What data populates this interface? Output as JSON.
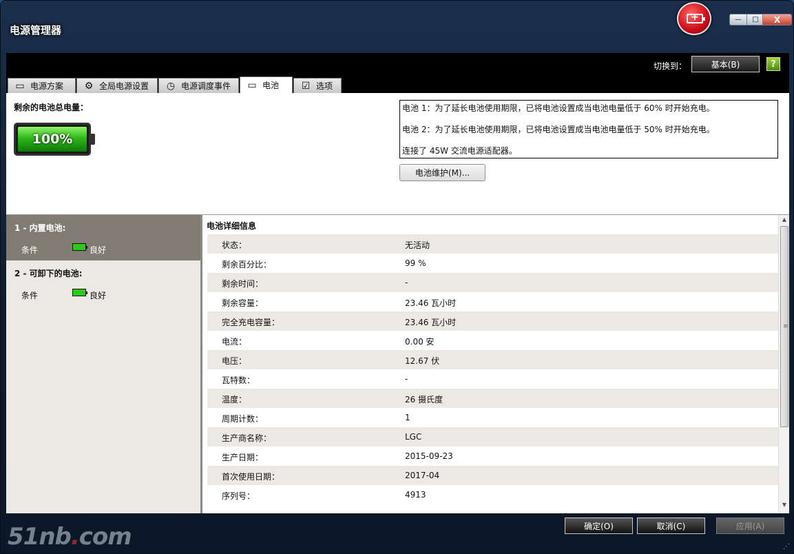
{
  "window": {
    "title": "电源管理器",
    "min_glyph": "—",
    "max_glyph": "□",
    "close_glyph": "X"
  },
  "header": {
    "switch_label": "切换到：",
    "basic_button": "基本(B)",
    "help_glyph": "?"
  },
  "tabs": [
    {
      "label": "电源方案",
      "icon": "battery-outline-icon",
      "glyph": "▭"
    },
    {
      "label": "全局电源设置",
      "icon": "gear-icon",
      "glyph": "⚙"
    },
    {
      "label": "电源调度事件",
      "icon": "clock-icon",
      "glyph": "◷"
    },
    {
      "label": "电池",
      "icon": "battery-icon",
      "glyph": "▭"
    },
    {
      "label": "选项",
      "icon": "checkbox-icon",
      "glyph": "☑"
    }
  ],
  "active_tab": "电池",
  "summary": {
    "remaining_label": "剩余的电池总电量：",
    "percent_text": "100%",
    "percent_value": 100,
    "messages": [
      "电池 1：为了延长电池使用期限，已将电池设置成当电池电量低于 60% 时开始充电。",
      "电池 2：为了延长电池使用期限，已将电池设置成当电池电量低于 50% 时开始充电。",
      "连接了 45W 交流电源适配器。"
    ],
    "maintenance_button": "电池维护(M)..."
  },
  "batteries": [
    {
      "name": "1 - 内置电池:",
      "condition_label": "条件",
      "status": "良好"
    },
    {
      "name": "2 - 可卸下的电池:",
      "condition_label": "条件",
      "status": "良好"
    }
  ],
  "details": {
    "title": "电池详细信息",
    "rows": [
      {
        "label": "状态：",
        "value": "无活动"
      },
      {
        "label": "剩余百分比：",
        "value": "99 %"
      },
      {
        "label": "剩余时间：",
        "value": "-"
      },
      {
        "label": "剩余容量：",
        "value": "23.46 瓦小时"
      },
      {
        "label": "完全充电容量：",
        "value": "23.46 瓦小时"
      },
      {
        "label": "电流：",
        "value": "0.00 安"
      },
      {
        "label": "电压：",
        "value": "12.67 伏"
      },
      {
        "label": "瓦特数：",
        "value": "-"
      },
      {
        "label": "温度：",
        "value": "26 摄氏度"
      },
      {
        "label": "周期计数：",
        "value": "1"
      },
      {
        "label": "生产商名称：",
        "value": "LGC"
      },
      {
        "label": "生产日期：",
        "value": "2015-09-23"
      },
      {
        "label": "首次使用日期：",
        "value": "2017-04"
      },
      {
        "label": "序列号：",
        "value": "4913"
      }
    ]
  },
  "footer": {
    "ok_button": "确定(O)",
    "cancel_button": "取消(C)",
    "apply_button": "应用(A)"
  },
  "watermark": {
    "text_a": "51nb",
    "dot": ".",
    "text_b": "com"
  }
}
